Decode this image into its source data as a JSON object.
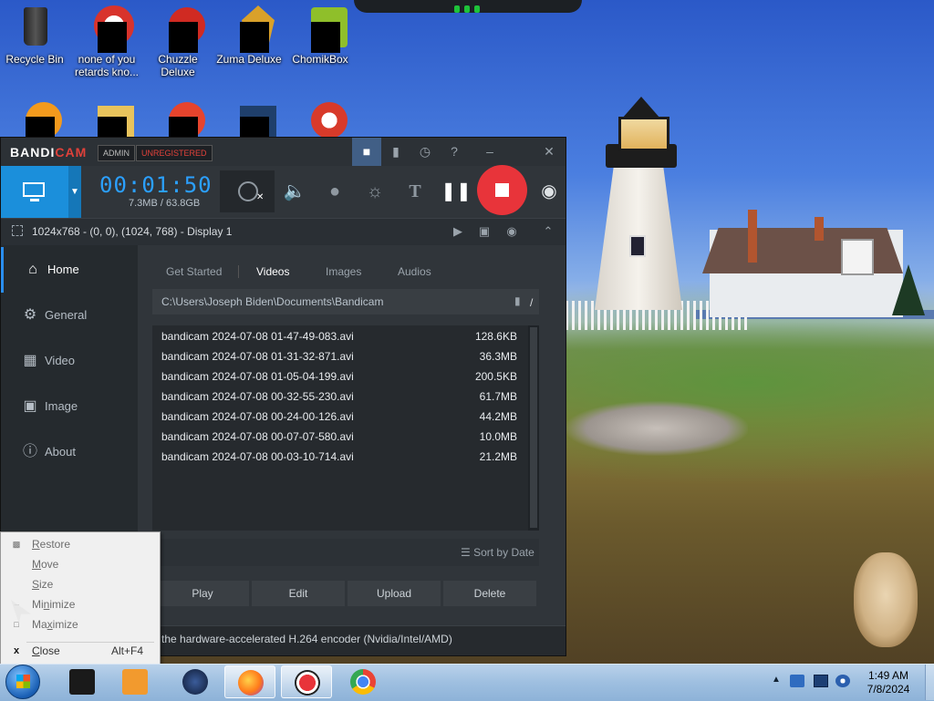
{
  "desktop": {
    "icons": [
      {
        "label": "Recycle Bin"
      },
      {
        "label": "none of you retards kno..."
      },
      {
        "label": "Chuzzle Deluxe"
      },
      {
        "label": "Zuma Deluxe"
      },
      {
        "label": "ChomikBox"
      }
    ]
  },
  "bandicam": {
    "logo_part1": "BANDI",
    "logo_part2": "CAM",
    "badge_admin": "ADMIN",
    "badge_unregistered": "UNREGISTERED",
    "timer": "00:01:50",
    "size": "7.3MB / 63.8GB",
    "status": "1024x768 - (0, 0), (1024, 768) - Display 1",
    "nav": [
      {
        "label": "Home",
        "icon": "home-icon"
      },
      {
        "label": "General",
        "icon": "gear-icon"
      },
      {
        "label": "Video",
        "icon": "video-icon"
      },
      {
        "label": "Image",
        "icon": "image-icon"
      },
      {
        "label": "About",
        "icon": "info-icon"
      }
    ],
    "tabs": [
      "Get Started",
      "Videos",
      "Images",
      "Audios"
    ],
    "path": "C:\\Users\\Joseph Biden\\Documents\\Bandicam",
    "path_slash": "/",
    "files": [
      {
        "name": "bandicam 2024-07-08 01-47-49-083.avi",
        "size": "128.6KB"
      },
      {
        "name": "bandicam 2024-07-08 01-31-32-871.avi",
        "size": "36.3MB"
      },
      {
        "name": "bandicam 2024-07-08 01-05-04-199.avi",
        "size": "200.5KB"
      },
      {
        "name": "bandicam 2024-07-08 00-32-55-230.avi",
        "size": "61.7MB"
      },
      {
        "name": "bandicam 2024-07-08 00-24-00-126.avi",
        "size": "44.2MB"
      },
      {
        "name": "bandicam 2024-07-08 00-07-07-580.avi",
        "size": "10.0MB"
      },
      {
        "name": "bandicam 2024-07-08 00-03-10-714.avi",
        "size": "21.2MB"
      }
    ],
    "sort": "Sort by Date",
    "actions": {
      "play": "Play",
      "edit": "Edit",
      "upload": "Upload",
      "delete": "Delete"
    },
    "footer": "the hardware-accelerated H.264 encoder (Nvidia/Intel/AMD)"
  },
  "context_menu": {
    "restore_u": "R",
    "restore_rest": "estore",
    "move_u": "M",
    "move_rest": "ove",
    "size_u": "S",
    "size_rest": "ize",
    "minimize_pre": "Mi",
    "minimize_u": "n",
    "minimize_rest": "imize",
    "maximize_pre": "Ma",
    "maximize_u": "x",
    "maximize_rest": "imize",
    "close_u": "C",
    "close_rest": "lose",
    "close_shortcut": "Alt+F4",
    "close_icon_glyph": "x"
  },
  "taskbar": {
    "time": "1:49 AM",
    "date": "7/8/2024"
  },
  "colors": {
    "accent": "#1b8fdb",
    "record": "#e8343a",
    "timer": "#2ba0ff"
  }
}
